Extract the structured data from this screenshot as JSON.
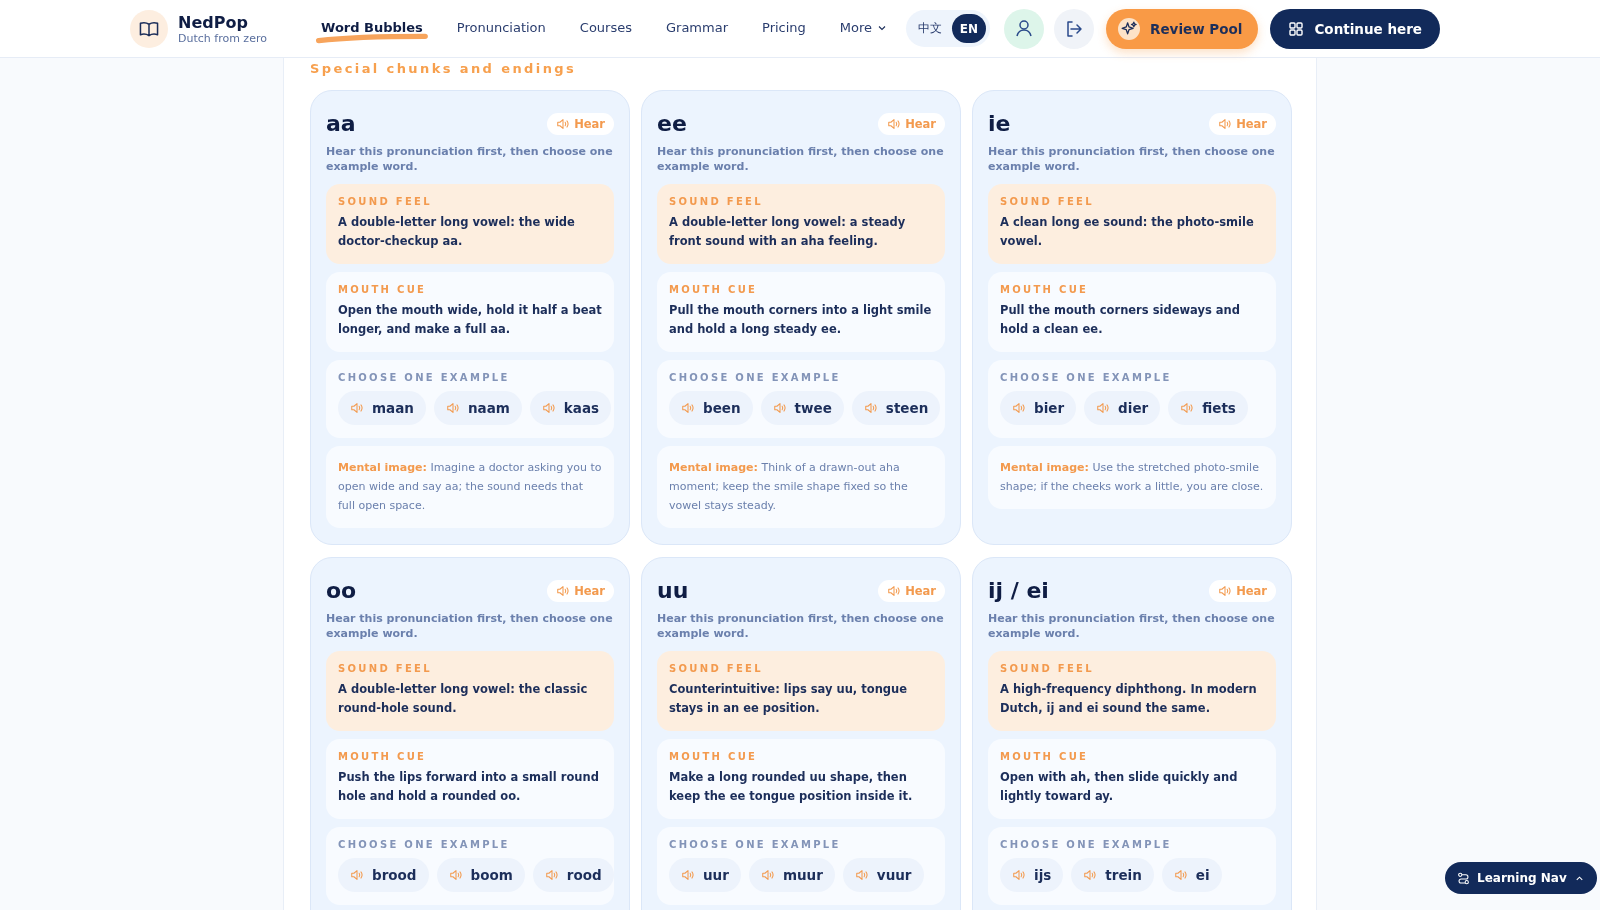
{
  "brand": {
    "name": "NedPop",
    "tagline": "Dutch from zero"
  },
  "nav": [
    {
      "label": "Word Bubbles",
      "selected": true
    },
    {
      "label": "Pronunciation",
      "selected": false
    },
    {
      "label": "Courses",
      "selected": false
    },
    {
      "label": "Grammar",
      "selected": false
    },
    {
      "label": "Pricing",
      "selected": false
    },
    {
      "label": "More",
      "selected": false,
      "kind": "dropdown"
    }
  ],
  "languages": [
    {
      "label": "中文",
      "selected": false
    },
    {
      "label": "EN",
      "selected": true
    }
  ],
  "actions": [
    {
      "label": "Review Pool",
      "kind": "review"
    },
    {
      "label": "Continue here",
      "kind": "continue"
    }
  ],
  "section_title": "Special chunks and endings",
  "cards": [
    {
      "title": "aa",
      "hear": "Hear",
      "intro": "Hear this pronunciation first, then choose one example word.",
      "sound_feel_label": "SOUND FEEL",
      "sound_feel": "A double-letter long vowel: the wide doctor-checkup aa.",
      "mouth_cue_label": "MOUTH CUE",
      "mouth_cue": "Open the mouth wide, hold it half a beat longer, and make a full aa.",
      "examples_label": "CHOOSE ONE EXAMPLE",
      "examples": [
        "maan",
        "naam",
        "kaas"
      ],
      "mental_label": "Mental image:",
      "mental": "Imagine a doctor asking you to open wide and say aa; the sound needs that full open space."
    },
    {
      "title": "ee",
      "hear": "Hear",
      "intro": "Hear this pronunciation first, then choose one example word.",
      "sound_feel_label": "SOUND FEEL",
      "sound_feel": "A double-letter long vowel: a steady front sound with an aha feeling.",
      "mouth_cue_label": "MOUTH CUE",
      "mouth_cue": "Pull the mouth corners into a light smile and hold a long steady ee.",
      "examples_label": "CHOOSE ONE EXAMPLE",
      "examples": [
        "been",
        "twee",
        "steen"
      ],
      "mental_label": "Mental image:",
      "mental": "Think of a drawn-out aha moment; keep the smile shape fixed so the vowel stays steady."
    },
    {
      "title": "ie",
      "hear": "Hear",
      "intro": "Hear this pronunciation first, then choose one example word.",
      "sound_feel_label": "SOUND FEEL",
      "sound_feel": "A clean long ee sound: the photo-smile vowel.",
      "mouth_cue_label": "MOUTH CUE",
      "mouth_cue": "Pull the mouth corners sideways and hold a clean ee.",
      "examples_label": "CHOOSE ONE EXAMPLE",
      "examples": [
        "bier",
        "dier",
        "fiets"
      ],
      "mental_label": "Mental image:",
      "mental": "Use the stretched photo-smile shape; if the cheeks work a little, you are close."
    },
    {
      "title": "oo",
      "hear": "Hear",
      "intro": "Hear this pronunciation first, then choose one example word.",
      "sound_feel_label": "SOUND FEEL",
      "sound_feel": "A double-letter long vowel: the classic round-hole sound.",
      "mouth_cue_label": "MOUTH CUE",
      "mouth_cue": "Push the lips forward into a small round hole and hold a rounded oo.",
      "examples_label": "CHOOSE ONE EXAMPLE",
      "examples": [
        "brood",
        "boom",
        "rood"
      ]
    },
    {
      "title": "uu",
      "hear": "Hear",
      "intro": "Hear this pronunciation first, then choose one example word.",
      "sound_feel_label": "SOUND FEEL",
      "sound_feel": "Counterintuitive: lips say uu, tongue stays in an ee position.",
      "mouth_cue_label": "MOUTH CUE",
      "mouth_cue": "Make a long rounded uu shape, then keep the ee tongue position inside it.",
      "examples_label": "CHOOSE ONE EXAMPLE",
      "examples": [
        "uur",
        "muur",
        "vuur"
      ]
    },
    {
      "title": "ij / ei",
      "hear": "Hear",
      "intro": "Hear this pronunciation first, then choose one example word.",
      "sound_feel_label": "SOUND FEEL",
      "sound_feel": "A high-frequency diphthong. In modern Dutch, ij and ei sound the same.",
      "mouth_cue_label": "MOUTH CUE",
      "mouth_cue": "Open with ah, then slide quickly and lightly toward ay.",
      "examples_label": "CHOOSE ONE EXAMPLE",
      "examples": [
        "ijs",
        "trein",
        "ei"
      ]
    }
  ],
  "learning_nav": {
    "label": "Learning Nav"
  }
}
